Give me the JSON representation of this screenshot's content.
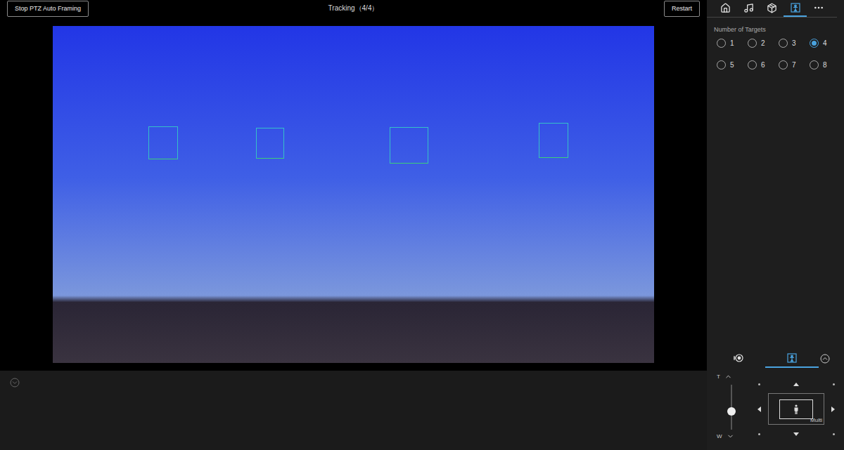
{
  "toolbar": {
    "stop_button": "Stop PTZ Auto Framing",
    "status": "Tracking（4/4）",
    "restart_button": "Restart"
  },
  "video": {
    "tracked_faces": [
      {
        "tracking": true
      },
      {
        "tracking": true
      },
      {
        "tracking": true
      },
      {
        "tracking": true
      }
    ]
  },
  "top_tabs": [
    {
      "selected": false
    },
    {
      "selected": false
    },
    {
      "selected": false
    },
    {
      "selected": true
    },
    {
      "selected": false
    }
  ],
  "targets": {
    "label": "Number of Targets",
    "options": [
      {
        "label": "1",
        "selected": false
      },
      {
        "label": "2",
        "selected": false
      },
      {
        "label": "3",
        "selected": false
      },
      {
        "label": "4",
        "selected": true
      },
      {
        "label": "5",
        "selected": false
      },
      {
        "label": "6",
        "selected": false
      },
      {
        "label": "7",
        "selected": false
      },
      {
        "label": "8",
        "selected": false
      }
    ]
  },
  "bottom_tabs": [
    {
      "selected": false
    },
    {
      "selected": true
    }
  ],
  "zoom": {
    "tele": "T",
    "wide": "W",
    "level": 0.4
  },
  "framing": {
    "label": "Multi"
  }
}
